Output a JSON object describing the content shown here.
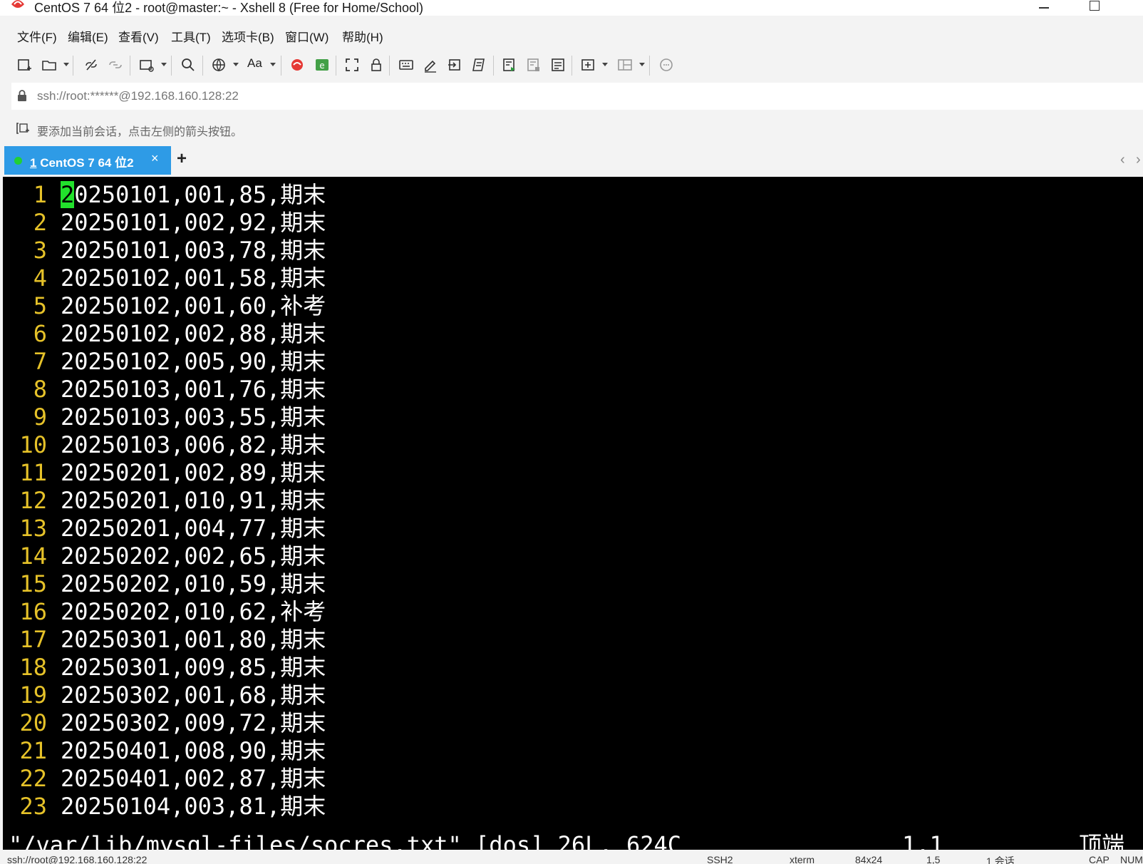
{
  "window": {
    "title": "CentOS 7 64 位2 - root@master:~ - Xshell 8 (Free for Home/School)"
  },
  "menu": [
    "文件(F)",
    "编辑(E)",
    "查看(V)",
    "工具(T)",
    "选项卡(B)",
    "窗口(W)",
    "帮助(H)"
  ],
  "toolbar": {
    "font_label": "Aa"
  },
  "address": {
    "value": "ssh://root:******@192.168.160.128:22"
  },
  "hint": {
    "text": "要添加当前会话，点击左侧的箭头按钮。"
  },
  "tabs": [
    {
      "index": "1",
      "label": "CentOS 7 64 位2",
      "active": true,
      "status_color": "#21d035"
    }
  ],
  "terminal": {
    "lines": [
      {
        "num": "1",
        "text": "20250101,001,85,期末"
      },
      {
        "num": "2",
        "text": "20250101,002,92,期末"
      },
      {
        "num": "3",
        "text": "20250101,003,78,期末"
      },
      {
        "num": "4",
        "text": "20250102,001,58,期末"
      },
      {
        "num": "5",
        "text": "20250102,001,60,补考"
      },
      {
        "num": "6",
        "text": "20250102,002,88,期末"
      },
      {
        "num": "7",
        "text": "20250102,005,90,期末"
      },
      {
        "num": "8",
        "text": "20250103,001,76,期末"
      },
      {
        "num": "9",
        "text": "20250103,003,55,期末"
      },
      {
        "num": "10",
        "text": "20250103,006,82,期末"
      },
      {
        "num": "11",
        "text": "20250201,002,89,期末"
      },
      {
        "num": "12",
        "text": "20250201,010,91,期末"
      },
      {
        "num": "13",
        "text": "20250201,004,77,期末"
      },
      {
        "num": "14",
        "text": "20250202,002,65,期末"
      },
      {
        "num": "15",
        "text": "20250202,010,59,期末"
      },
      {
        "num": "16",
        "text": "20250202,010,62,补考"
      },
      {
        "num": "17",
        "text": "20250301,001,80,期末"
      },
      {
        "num": "18",
        "text": "20250301,009,85,期末"
      },
      {
        "num": "19",
        "text": "20250302,001,68,期末"
      },
      {
        "num": "20",
        "text": "20250302,009,72,期末"
      },
      {
        "num": "21",
        "text": "20250401,008,90,期末"
      },
      {
        "num": "22",
        "text": "20250401,002,87,期末"
      },
      {
        "num": "23",
        "text": "20250104,003,81,期末"
      }
    ],
    "status_file": "\"/var/lib/mysql-files/socres.txt\" [dos] 26L, 624C",
    "status_position": "1,1",
    "status_scroll": "顶端",
    "colors": {
      "background": "#000000",
      "line_number": "#e6c229",
      "text": "#ffffff",
      "cursor": "#22e12c"
    }
  },
  "statusbar": {
    "address": "ssh://root@192.168.160.128:22",
    "protocol": "SSH2",
    "terminal_type": "xterm",
    "size": "84x24",
    "cursor_pos": "1,5",
    "sessions": "1 会话",
    "caps": "CAP",
    "num": "NUM"
  }
}
